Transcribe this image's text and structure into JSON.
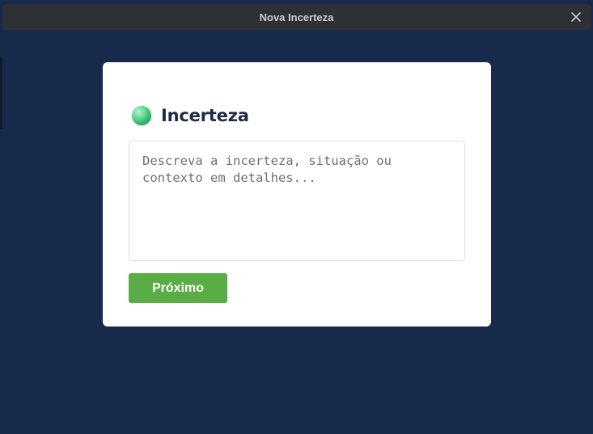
{
  "window": {
    "title": "Nova Incerteza"
  },
  "form": {
    "heading": "Incerteza",
    "heading_icon": "green-orb-icon",
    "description": {
      "value": "",
      "placeholder": "Descreva a incerteza, situação ou contexto em detalhes..."
    },
    "next_label": "Próximo"
  },
  "colors": {
    "background": "#172a4c",
    "titlebar": "#2d3135",
    "card": "#ffffff",
    "accent_button": "#5aad44",
    "heading_text": "#1f2a44"
  }
}
